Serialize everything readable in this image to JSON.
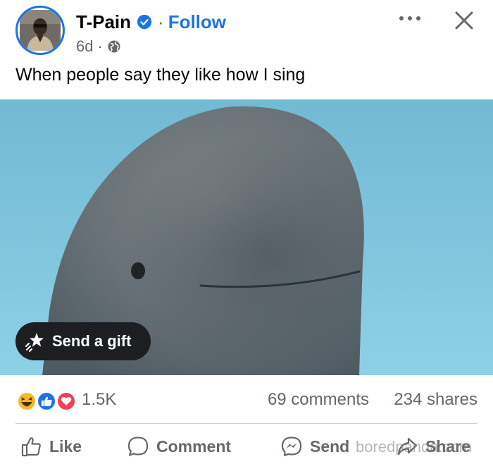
{
  "post": {
    "author": "T-Pain",
    "follow_label": "Follow",
    "separator": "·",
    "timestamp": "6d",
    "caption": "When people say they like how I sing"
  },
  "media": {
    "gift_label": "Send a gift"
  },
  "stats": {
    "reactions_count": "1.5K",
    "reaction_icons": [
      "haha-icon",
      "like-icon",
      "love-icon"
    ],
    "comments": "69 comments",
    "shares": "234 shares"
  },
  "actions": {
    "like_label": "Like",
    "comment_label": "Comment",
    "send_label": "Send",
    "share_label": "Share"
  },
  "watermark": "boredpanda.com",
  "colors": {
    "accent": "#1b74e4",
    "secondary_text": "#65676b",
    "gift_pill": "#1c1e21",
    "love": "#f33e58",
    "haha": "#f7b928"
  }
}
